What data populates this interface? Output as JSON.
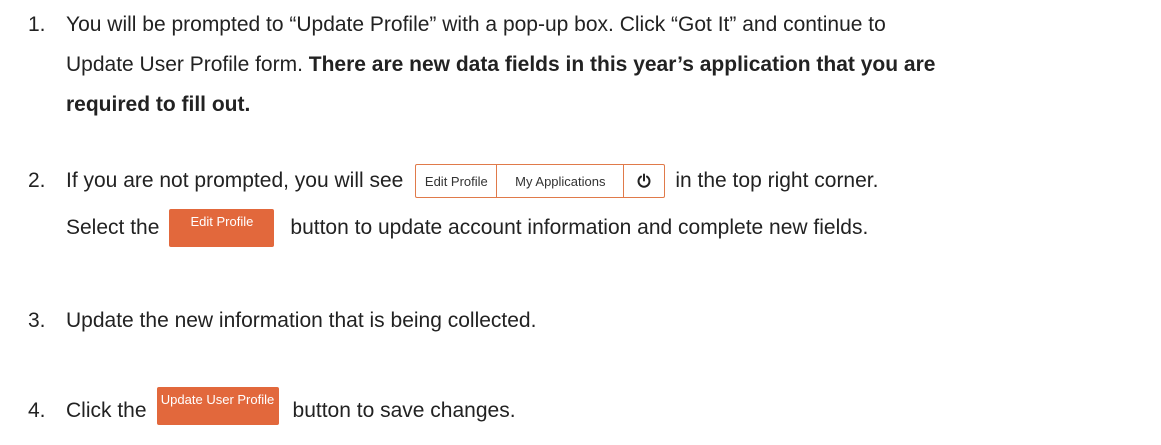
{
  "steps": [
    {
      "number": "1.",
      "line1": "You will be prompted to “Update Profile” with a pop-up box. Click “Got It” and continue to",
      "line2_plain": "Update User Profile form. ",
      "line2_bold": "There are new data fields in this year’s application that you are",
      "line3_bold": "required to fill out."
    },
    {
      "number": "2.",
      "line1_before": "If you are not prompted, you will see",
      "line1_after": "in the top right corner.",
      "line2_before": "Select the",
      "line2_after": "button to update account information and complete new fields."
    },
    {
      "number": "3.",
      "text": "Update the new information that is being collected."
    },
    {
      "number": "4.",
      "before": "Click the",
      "after": "button to save changes."
    }
  ],
  "nav_group": {
    "edit_profile": "Edit Profile",
    "my_applications": "My Applications",
    "power_icon": "power-icon"
  },
  "buttons": {
    "edit_profile": "Edit Profile",
    "update_user_profile": "Update User Profile"
  },
  "colors": {
    "accent": "#e2683c",
    "border": "#e07a4a",
    "text": "#222222"
  }
}
